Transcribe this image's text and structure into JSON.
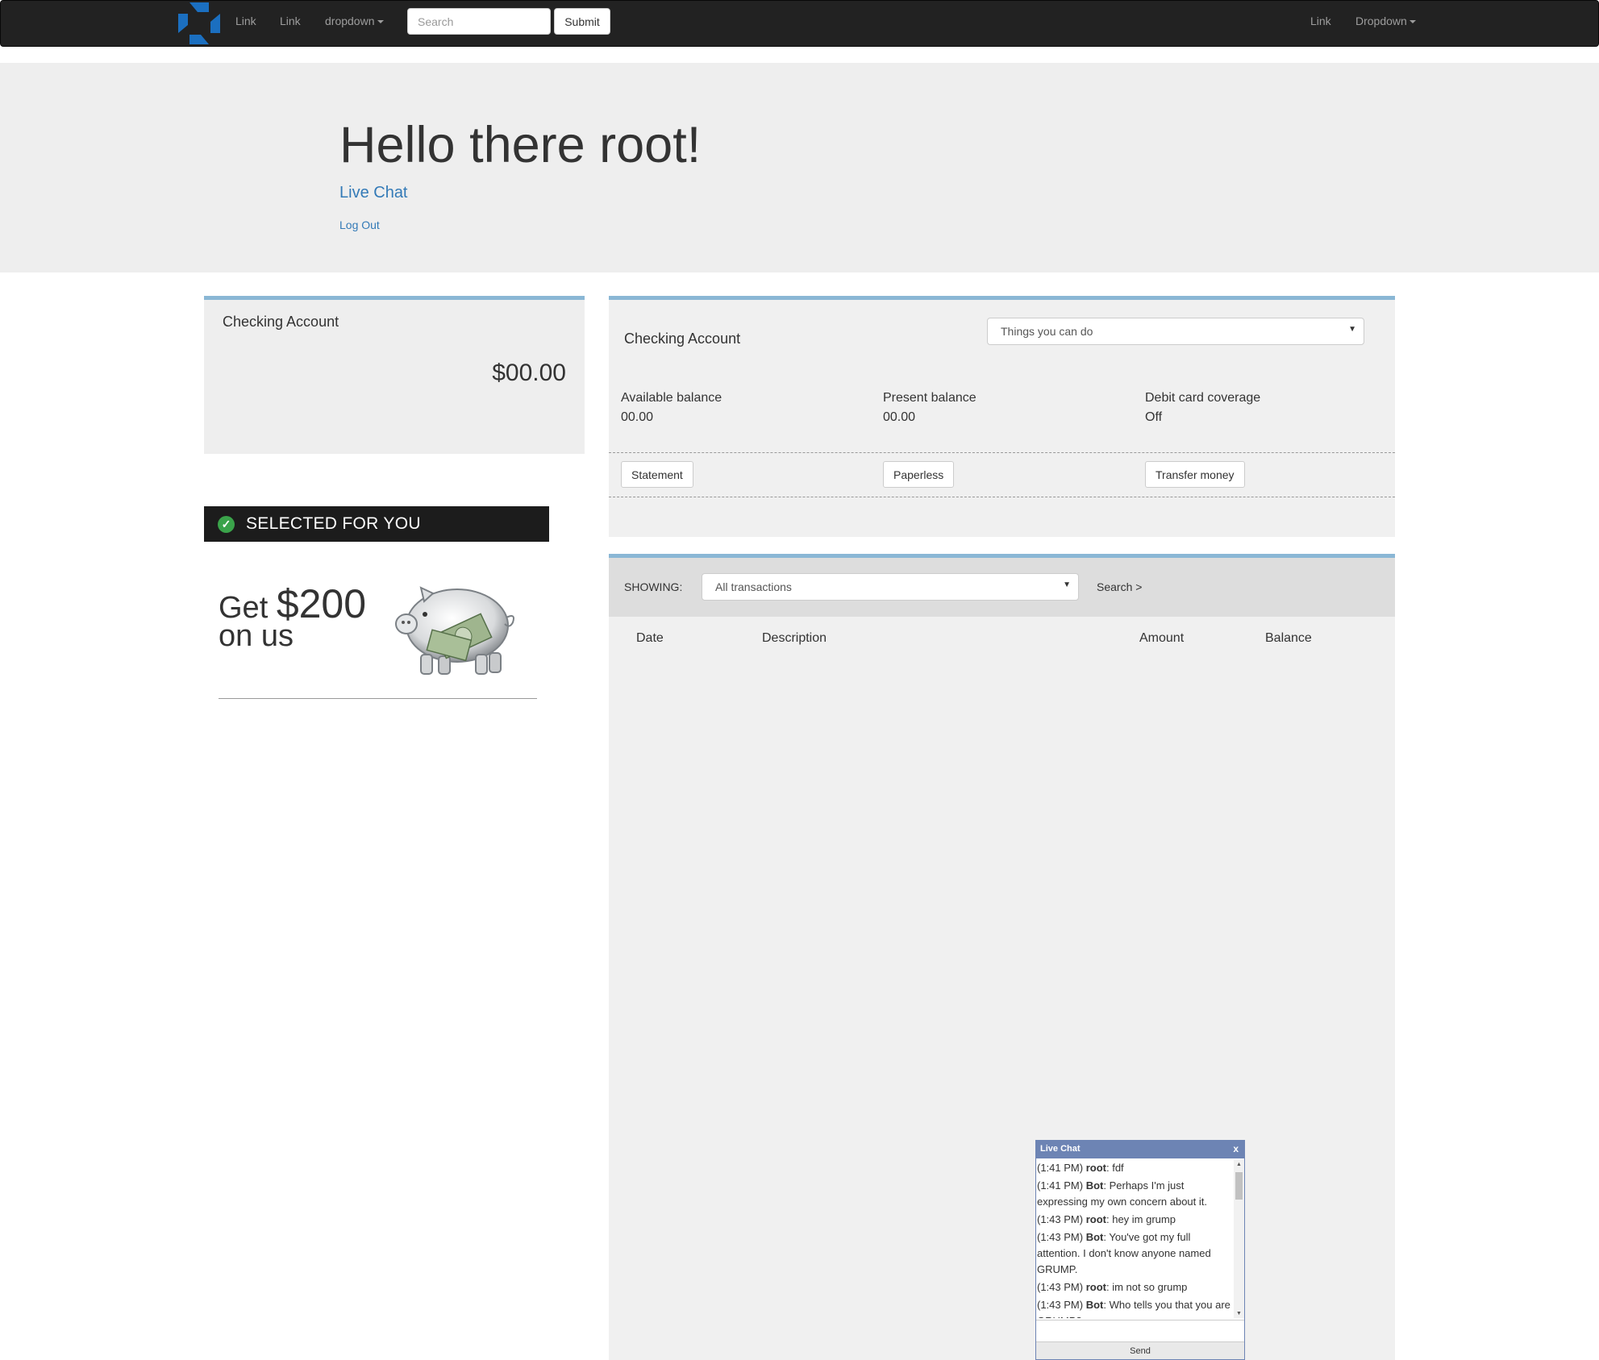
{
  "navbar": {
    "links_left": [
      "Link",
      "Link"
    ],
    "dropdown_left": "dropdown",
    "search_placeholder": "Search",
    "submit_label": "Submit",
    "link_right": "Link",
    "dropdown_right": "Dropdown",
    "logo_color": "#1b6fc0"
  },
  "jumbotron": {
    "greeting": "Hello there root!",
    "live_chat_link": "Live Chat",
    "logout_link": "Log Out"
  },
  "summary": {
    "title": "Checking Account",
    "balance": "$00.00"
  },
  "promo": {
    "banner": "SELECTED FOR YOU",
    "get": "Get",
    "amount": "$200",
    "on_us": "on us"
  },
  "details": {
    "title": "Checking Account",
    "things_select": "Things you can do",
    "balances": [
      {
        "label": "Available balance",
        "value": "00.00"
      },
      {
        "label": "Present balance",
        "value": "00.00"
      },
      {
        "label": "Debit card coverage",
        "value": "Off"
      }
    ],
    "buttons": [
      "Statement",
      "Paperless",
      "Transfer money"
    ]
  },
  "transactions": {
    "showing_label": "SHOWING:",
    "filter": "All transactions",
    "search_link": "Search >",
    "columns": [
      "Date",
      "Description",
      "Amount",
      "Balance"
    ]
  },
  "chat": {
    "title": "Live Chat",
    "close": "x",
    "send_label": "Send",
    "messages": [
      {
        "time": "(1:41 PM)",
        "sender": "root",
        "text": ": fdf"
      },
      {
        "time": "(1:41 PM)",
        "sender": "Bot",
        "text": ": Perhaps I'm just expressing my own concern about it."
      },
      {
        "time": "(1:43 PM)",
        "sender": "root",
        "text": ": hey im grump"
      },
      {
        "time": "(1:43 PM)",
        "sender": "Bot",
        "text": ": You've got my full attention. I don't know anyone named GRUMP."
      },
      {
        "time": "(1:43 PM)",
        "sender": "root",
        "text": ": im not so grump"
      },
      {
        "time": "(1:43 PM)",
        "sender": "Bot",
        "text": ": Who tells you that you are GRUMP?"
      }
    ]
  },
  "colors": {
    "accent_border": "#8ab7d5",
    "link_blue": "#337ab7",
    "navbar_bg": "#222222",
    "chat_header": "#6d84b4"
  }
}
